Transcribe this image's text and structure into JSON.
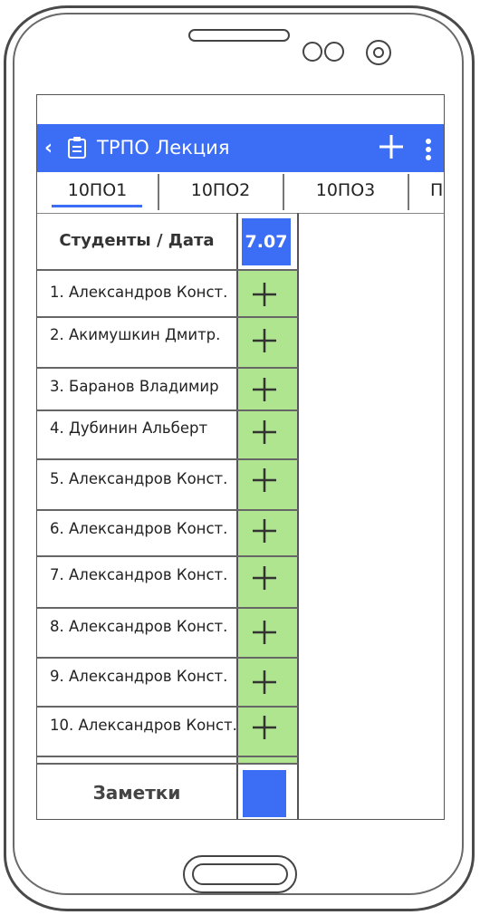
{
  "app": {
    "title": "ТРПО Лекция"
  },
  "tabs": [
    {
      "label": "10ПО1",
      "active": true
    },
    {
      "label": "10ПО2",
      "active": false
    },
    {
      "label": "10ПО3",
      "active": false
    },
    {
      "label": "П",
      "active": false
    }
  ],
  "table": {
    "header_label": "Студенты / Дата",
    "date": "7.07",
    "students": [
      {
        "num": "1.",
        "name": "Александров Конст.",
        "mark": "+"
      },
      {
        "num": "2.",
        "name": "Акимушкин Дмитр.",
        "mark": "+"
      },
      {
        "num": "3.",
        "name": "Баранов Владимир",
        "mark": "+"
      },
      {
        "num": "4.",
        "name": "Дубинин Альберт",
        "mark": "+"
      },
      {
        "num": "5.",
        "name": "Александров Конст.",
        "mark": "+"
      },
      {
        "num": "6.",
        "name": "Александров Конст.",
        "mark": "+"
      },
      {
        "num": "7.",
        "name": "Александров Конст.",
        "mark": "+"
      },
      {
        "num": "8.",
        "name": "Александров Конст.",
        "mark": "+"
      },
      {
        "num": "9.",
        "name": "Александров Конст.",
        "mark": "+"
      },
      {
        "num": "10.",
        "name": "Александров Конст.",
        "mark": "+"
      }
    ],
    "notes_label": "Заметки"
  },
  "icons": {
    "back": "back-icon",
    "clipboard": "clipboard-icon",
    "add": "add-icon",
    "more": "more-vertical-icon"
  },
  "colors": {
    "accent": "#3c6ef5",
    "present": "#aee58e"
  }
}
